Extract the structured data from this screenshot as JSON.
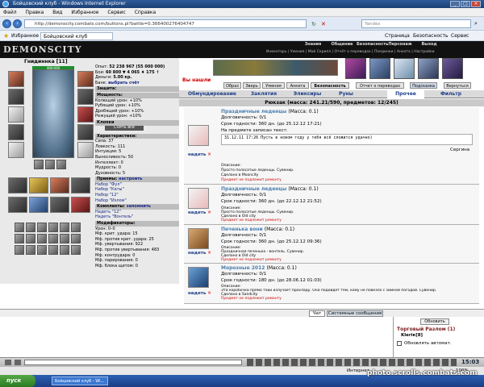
{
  "window": {
    "title": "Бойцовский клуб - Windows Internet Explorer"
  },
  "menu": [
    "Файл",
    "Правка",
    "Вид",
    "Избранное",
    "Сервис",
    "Справка"
  ],
  "address": {
    "url": "http://demonscity.combats.com/buttons.pl?battle=0.366400276404747",
    "search_placeholder": "Yandex"
  },
  "favbar": {
    "favorites": "Избранное",
    "tab": "Бойцовский клуб",
    "tools": [
      "Страница",
      "Безопасность",
      "Сервис"
    ]
  },
  "game": {
    "logo": "DEMONSCITY",
    "top_menu": [
      "Знания",
      "Общение",
      "Безопасность",
      "Персонаж",
      "Выход"
    ],
    "sub_menu": "Инвентарь | Умения | Мой Скрилл | Отчёт о переводах | Поединки | Анкета | Настройки"
  },
  "character": {
    "name": "Гнидиннка [11]",
    "hp": "480/480",
    "stats": [
      {
        "label": "Опыт:",
        "value": "52 238 967 (55 000 000)"
      },
      {
        "label": "Бои:",
        "value": "60 800 ▼ 4 065 ♦ 175 ↑"
      },
      {
        "label": "Деньги:",
        "value": "5.00 кр."
      },
      {
        "label": "Банк:",
        "value": "выбрать счёт"
      }
    ],
    "sections": {
      "defense": "Защита:",
      "power": "Мощность:",
      "power_items": [
        "Колющий урон: +10%",
        "Рубящий урон: +10%",
        "Дробящий урон: +10%",
        "Режущий урон: +10%"
      ],
      "knights": "Клопки",
      "chars": "Характеристики:",
      "chars_items": [
        "Сила: 37",
        "Ловкость: 111",
        "Интуиция: 5",
        "Выносливость: 50",
        "Интеллект: 0",
        "Мудрость: 0",
        "Духовность: 5"
      ],
      "techniques": "Приемы:",
      "techniques_link": "настроить",
      "techniques_items": [
        "Набор \"Фул\"",
        "Набор \"Каты\"",
        "Набор \"12\"",
        "Набор \"Излом\""
      ],
      "sets": "Комплекты:",
      "sets_link": "запомнить",
      "sets_items": [
        "Надеть \"12\"",
        "Надеть \"Вонтель\""
      ],
      "modifiers": "Модификаторы:",
      "modifiers_items": [
        "Урон: 0–0",
        "Мф. крит. удара: 15",
        "Мф. против крит. удара: 25",
        "Мф. увертывания: 922",
        "Мф. против увертывания: 483",
        "Мф. контрудара: 0",
        "Мф. парирования: 0",
        "Мф. блока щитом: 0"
      ]
    },
    "change_btn": "Снять всё"
  },
  "inventory": {
    "found": "Вы нашли",
    "toolbar": [
      "Образ",
      "Зверь",
      "Умения",
      "Анкета",
      "Безопасность",
      "Отчет о переводах",
      "Подсказка",
      "Вернуться"
    ],
    "tabs": [
      "Обмундирование",
      "Заклятия",
      "Эликсиры",
      "Руны",
      "Прочее",
      "Фильтр"
    ],
    "active_tab": "Прочее",
    "backpack": "Рюкзак (масса: 241.21/590, предметов: 12/245)",
    "items": [
      {
        "name": "Праздничные леденцы",
        "mass": "(Масса: 0.1)",
        "durability": "Долговечность: 0/1",
        "term": "Срок годности: 360 дн. (до 25.12.12 17:21)",
        "inscr_label": "На предмете записан текст:",
        "inscr": "31.12.11 17:26 Пусть в новом году у тебя всё сложится удачно)",
        "signer": "Сергина",
        "desc_title": "Описание:",
        "desc": "Просто полосатые леденцы. Сувенир.",
        "made": "Сделано в Mooncity",
        "note": "Предмет не подлежит ремонту"
      },
      {
        "name": "Праздничные леденцы",
        "mass": "(Масса: 0.1)",
        "durability": "Долговечность: 0/1",
        "term": "Срок годности: 360 дн. (до 22.12.12 21:52)",
        "desc_title": "Описание:",
        "desc": "Просто полосатые леденцы. Сувенир.",
        "made": "Сделано в Old city",
        "note": "Предмет не подлежит ремонту"
      },
      {
        "name": "Печенька вони",
        "mass": "(Масса: 0.1)",
        "durability": "Долговечность: 0/1",
        "term": "Срок годности: 360 дн. (до 25.12.12 09:36)",
        "desc_title": "Описание:",
        "desc": "Праздничная печенька - вонтель. Сувенир.",
        "made": "Сделано в Old city",
        "note": "Предмет не подлежит ремонту"
      },
      {
        "name": "Морозные 2012",
        "mass": "(Масса: 0.1)",
        "durability": "Долговечность: 0/1",
        "term": "Срок годности: 180 дн. (до 28.06.12 01:03)",
        "desc_title": "Описание:",
        "desc": "Эта коробочка прямо таки излучает прохладу. Она подойдет тем, кому не повезло с зимней погодой. Сувенир.",
        "made": "Сделано в Sandcity",
        "note": "Предмет не подлежит ремонту"
      }
    ],
    "wear_label": "надеть"
  },
  "chat": {
    "tabs": [
      "Чат",
      "Системные сообщения"
    ],
    "trade_title": "Торговый Разлом (1)",
    "trade_user": "Kleriк[8]",
    "refresh": "Обновить",
    "auto": "Обновлять автомат."
  },
  "statusbar": {
    "zone": "Интернет",
    "zoom": "100%"
  },
  "taskbar": {
    "start": "пуск",
    "task": "Бойцовский клуб - Wi...",
    "clock": "15:03"
  },
  "watermark": "photo.scrolls.combats.com"
}
